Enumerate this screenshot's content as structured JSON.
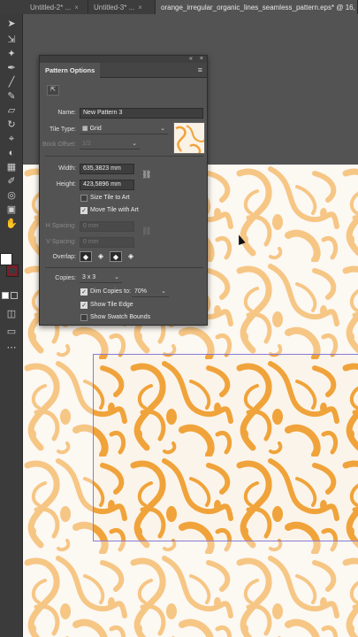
{
  "tabs": [
    {
      "label": "Untitled-2* ...",
      "close": "×"
    },
    {
      "label": "Untitled-3* ...",
      "close": "×"
    },
    {
      "label": "orange_irregular_organic_lines_seamless_pattern.eps* @ 16,"
    }
  ],
  "panel": {
    "collapse_glyph": "«",
    "close_glyph": "×",
    "title": "Pattern Options",
    "menu_glyph": "≡",
    "fit_tile_glyph": "⇱",
    "name_label": "Name:",
    "name_value": "New Pattern 3",
    "tile_type_label": "Tile Type:",
    "tile_type_value": "Grid",
    "tile_type_caret": "⌄",
    "brick_offset_label": "Brick Offset:",
    "brick_offset_value": "1/2",
    "width_label": "Width:",
    "width_value": "635,3823 mm",
    "height_label": "Height:",
    "height_value": "423,5896 mm",
    "size_tile_to_art": "Size Tile to Art",
    "move_tile_with_art": "Move Tile with Art",
    "h_spacing_label": "H Spacing:",
    "h_spacing_value": "0 mm",
    "v_spacing_label": "V Spacing:",
    "v_spacing_value": "0 mm",
    "overlap_label": "Overlap:",
    "copies_label": "Copies:",
    "copies_value": "3 x 3",
    "dim_copies_label": "Dim Copies to:",
    "dim_copies_value": "70%",
    "show_tile_edge": "Show Tile Edge",
    "show_swatch_bounds": "Show Swatch Bounds",
    "checks": {
      "size_tile_to_art": false,
      "move_tile_with_art": true,
      "dim_copies": true,
      "show_tile_edge": true,
      "show_swatch_bounds": false
    }
  },
  "colors": {
    "pattern_orange": "#f0a33a",
    "pattern_light": "#f6c98a",
    "canvas_bg": "#fbf4ea",
    "tile_edge": "#8a7ad8"
  }
}
